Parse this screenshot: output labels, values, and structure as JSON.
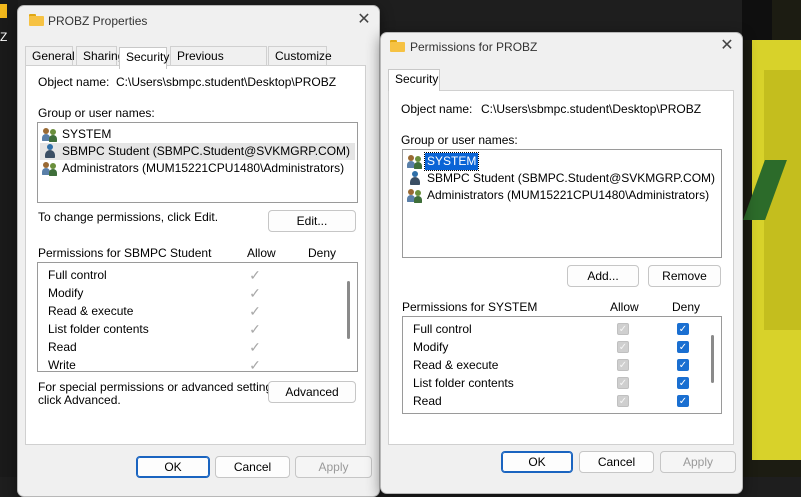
{
  "desktop": {
    "left_glyph": "Z"
  },
  "colors": {
    "accent": "#0a64d6",
    "check_blue": "#1a6fd1",
    "folder": "#f6c243"
  },
  "properties": {
    "title": "PROBZ Properties",
    "tabs": [
      "General",
      "Sharing",
      "Security",
      "Previous Versions",
      "Customize"
    ],
    "active_tab": "Security",
    "object_label": "Object name:",
    "object_value": "C:\\Users\\sbmpc.student\\Desktop\\PROBZ",
    "groups_label": "Group or user names:",
    "users": [
      {
        "icon": "users-group-icon",
        "name": "SYSTEM"
      },
      {
        "icon": "user-icon",
        "name": "SBMPC Student (SBMPC.Student@SVKMGRP.COM)"
      },
      {
        "icon": "users-group-icon",
        "name": "Administrators (MUM15221CPU1480\\Administrators)"
      }
    ],
    "hovered_user": 1,
    "change_text": "To change permissions, click Edit.",
    "edit_button": "Edit...",
    "perm_header": "Permissions for SBMPC Student",
    "allow_header": "Allow",
    "deny_header": "Deny",
    "permissions": [
      {
        "name": "Full control",
        "allow": true,
        "deny": false
      },
      {
        "name": "Modify",
        "allow": true,
        "deny": false
      },
      {
        "name": "Read & execute",
        "allow": true,
        "deny": false
      },
      {
        "name": "List folder contents",
        "allow": true,
        "deny": false
      },
      {
        "name": "Read",
        "allow": true,
        "deny": false
      },
      {
        "name": "Write",
        "allow": true,
        "deny": false
      }
    ],
    "special_line1": "For special permissions or advanced settings,",
    "special_line2": "click Advanced.",
    "advanced_button": "Advanced",
    "ok_button": "OK",
    "cancel_button": "Cancel",
    "apply_button": "Apply"
  },
  "permissions_dialog": {
    "title": "Permissions for PROBZ",
    "tab": "Security",
    "object_label": "Object name:",
    "object_value": "C:\\Users\\sbmpc.student\\Desktop\\PROBZ",
    "groups_label": "Group or user names:",
    "users": [
      {
        "icon": "users-group-icon",
        "name": "SYSTEM"
      },
      {
        "icon": "user-icon",
        "name": "SBMPC Student (SBMPC.Student@SVKMGRP.COM)"
      },
      {
        "icon": "users-group-icon",
        "name": "Administrators (MUM15221CPU1480\\Administrators)"
      }
    ],
    "selected_user": 0,
    "add_button": "Add...",
    "remove_button": "Remove",
    "perm_header": "Permissions for SYSTEM",
    "allow_header": "Allow",
    "deny_header": "Deny",
    "permissions": [
      {
        "name": "Full control",
        "allow": true,
        "deny": true
      },
      {
        "name": "Modify",
        "allow": true,
        "deny": true
      },
      {
        "name": "Read & execute",
        "allow": true,
        "deny": true
      },
      {
        "name": "List folder contents",
        "allow": true,
        "deny": true
      },
      {
        "name": "Read",
        "allow": true,
        "deny": true
      }
    ],
    "ok_button": "OK",
    "cancel_button": "Cancel",
    "apply_button": "Apply"
  }
}
